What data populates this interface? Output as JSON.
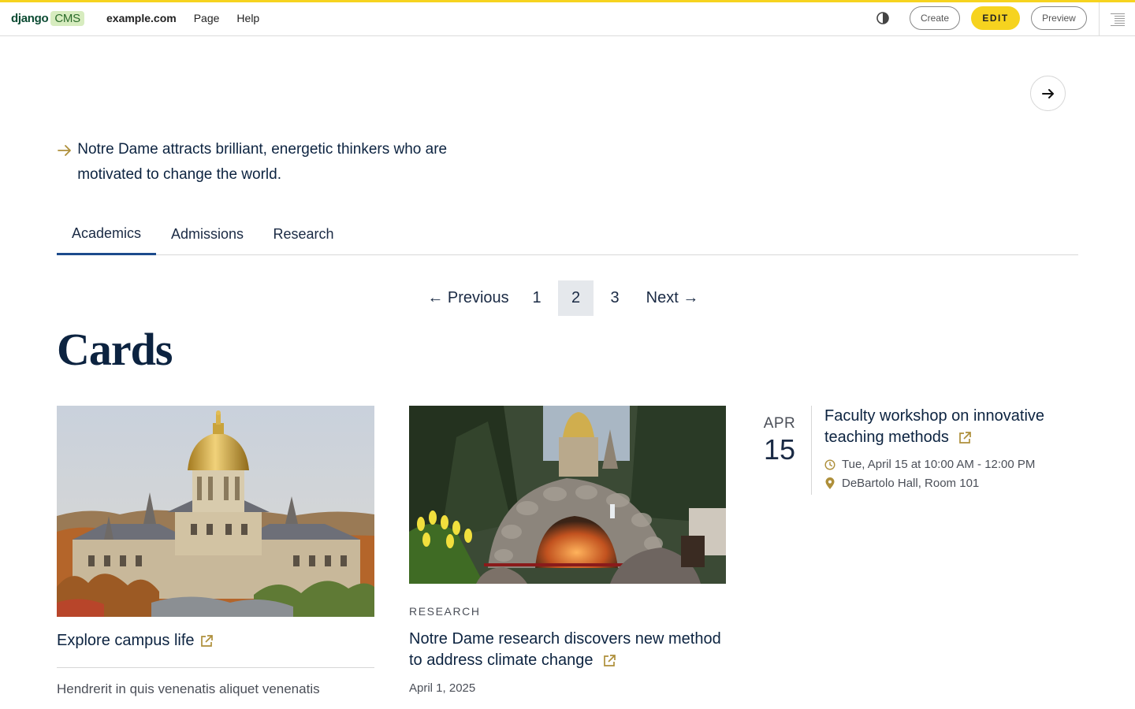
{
  "toolbar": {
    "logo_django": "django",
    "logo_cms": "CMS",
    "menu": [
      "example.com",
      "Page",
      "Help"
    ],
    "create_label": "Create",
    "edit_label": "EDIT",
    "preview_label": "Preview",
    "accent_color": "#f6d31f"
  },
  "quote": {
    "text": "Notre Dame attracts brilliant, energetic thinkers who are motivated to change the world.",
    "arrow_color": "#ae8f3a"
  },
  "tabs": [
    {
      "label": "Academics",
      "active": true
    },
    {
      "label": "Admissions",
      "active": false
    },
    {
      "label": "Research",
      "active": false
    }
  ],
  "pagination": {
    "previous": "← Previous",
    "pages": [
      "1",
      "2",
      "3"
    ],
    "current": "2",
    "next": "Next →"
  },
  "section_heading": "Cards",
  "cards": [
    {
      "image": "campus-golden-dome-photo",
      "title": "Explore campus life",
      "body": "Hendrerit in quis venenatis aliquet venenatis"
    },
    {
      "image": "grotto-photo",
      "category": "RESEARCH",
      "title": "Notre Dame research discovers new method to address climate change",
      "date": "April 1, 2025"
    }
  ],
  "event": {
    "month": "APR",
    "day": "15",
    "title": "Faculty workshop on innovative teaching methods",
    "time": "Tue, April 15 at 10:00 AM - 12:00 PM",
    "location": "DeBartolo Hall, Room 101"
  },
  "colors": {
    "navy": "#0c2340",
    "gold": "#ae8f3a",
    "tab_underline": "#1c4a8c"
  }
}
